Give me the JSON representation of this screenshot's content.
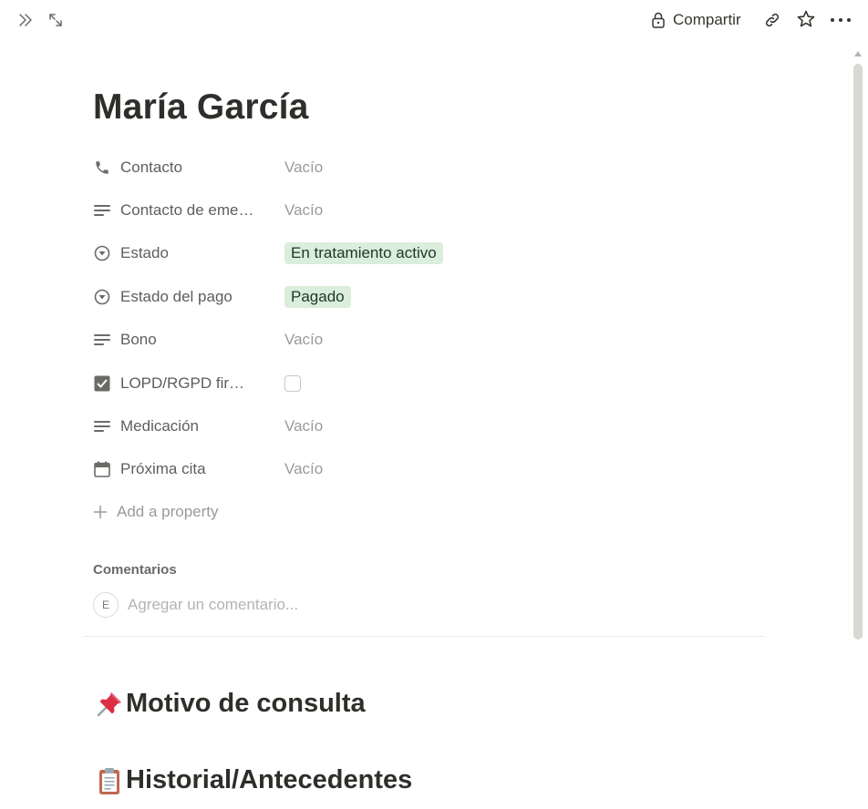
{
  "topbar": {
    "share_label": "Compartir",
    "icons": [
      "sidebar-toggle-icon",
      "expand-icon",
      "lock-icon",
      "link-icon",
      "star-icon",
      "more-icon"
    ]
  },
  "page": {
    "title": "María García"
  },
  "properties": [
    {
      "name": "Contacto",
      "icon": "phone-icon",
      "value": "Vacío",
      "type": "empty"
    },
    {
      "name": "Contacto de emergencia",
      "icon": "text-icon",
      "value": "Vacío",
      "type": "empty"
    },
    {
      "name": "Estado",
      "icon": "status-icon",
      "value": "En tratamiento activo",
      "type": "tag"
    },
    {
      "name": "Estado del pago",
      "icon": "status-icon",
      "value": "Pagado",
      "type": "tag"
    },
    {
      "name": "Bono",
      "icon": "text-icon",
      "value": "Vacío",
      "type": "empty"
    },
    {
      "name": "LOPD/RGPD firmado",
      "icon": "checkbox-icon",
      "value": "",
      "type": "checkbox",
      "checked": false
    },
    {
      "name": "Medicación",
      "icon": "text-icon",
      "value": "Vacío",
      "type": "empty"
    },
    {
      "name": "Próxima cita",
      "icon": "calendar-icon",
      "value": "Vacío",
      "type": "empty"
    }
  ],
  "add_property_label": "Add a property",
  "comments": {
    "title": "Comentarios",
    "avatar_initial": "E",
    "placeholder": "Agregar un comentario..."
  },
  "headings": [
    {
      "emoji": "pushpin-icon",
      "text": "Motivo de consulta"
    },
    {
      "emoji": "clipboard-icon",
      "text": "Historial/Antecedentes"
    }
  ],
  "colors": {
    "tag_bg": "#dbeddb",
    "tag_text": "#1c3829",
    "text_primary": "#37352f",
    "text_muted": "#9b9a97"
  }
}
